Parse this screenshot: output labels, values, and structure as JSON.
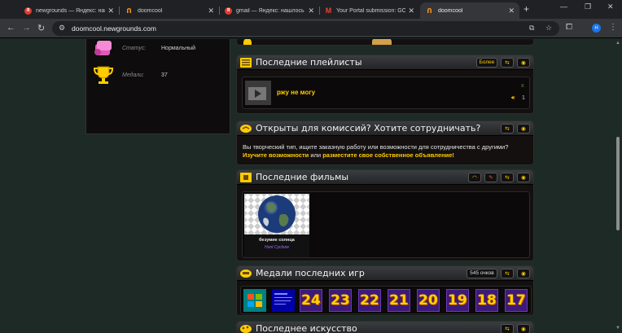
{
  "browser": {
    "tabs": [
      {
        "title": "newgrounds — Яндекс: нашл",
        "icon": "yandex-icon",
        "active": false
      },
      {
        "title": "doomcool",
        "icon": "newgrounds-icon",
        "active": false
      },
      {
        "title": "gmail — Яндекс: нашлось 1",
        "icon": "yandex-icon",
        "active": false
      },
      {
        "title": "Your Portal submission: GOIN",
        "icon": "gmail-icon",
        "active": false
      },
      {
        "title": "doomcool",
        "icon": "newgrounds-icon",
        "active": true
      }
    ],
    "url": "doomcool.newgrounds.com",
    "avatar_letter": "H"
  },
  "profile_panel": {
    "rows": [
      {
        "label": "Статус:",
        "value": "Нормальный",
        "icon": "pink-scroll-icon"
      },
      {
        "label": "Медали:",
        "value": "37",
        "icon": "trophy-icon"
      }
    ]
  },
  "playlists": {
    "title": "Последние плейлисты",
    "more_label": "Более",
    "item": {
      "name": "ржу не могу",
      "count": "1"
    }
  },
  "commissions": {
    "title": "Открыты для комиссий? Хотите сотрудничать?",
    "text": "Вы творческий тип, ищите заказную работу или возможности для сотрудничества с другими?",
    "link1": "Изучите возможности",
    "middle": " или ",
    "link2": "разместите свое собственное объявление!"
  },
  "movies": {
    "title": "Последние фильмы",
    "item": {
      "title": "безумие солнца",
      "author": "Hunt Cyclone"
    }
  },
  "medals": {
    "title": "Медали последних игр",
    "points": "545 очков",
    "numbers": [
      "24",
      "23",
      "22",
      "21",
      "20",
      "19",
      "18",
      "17"
    ]
  },
  "art": {
    "title": "Последнее искусство"
  },
  "colors": {
    "accent": "#ffcc00",
    "background": "#1e2a25",
    "panel": "#0e0c0c"
  }
}
